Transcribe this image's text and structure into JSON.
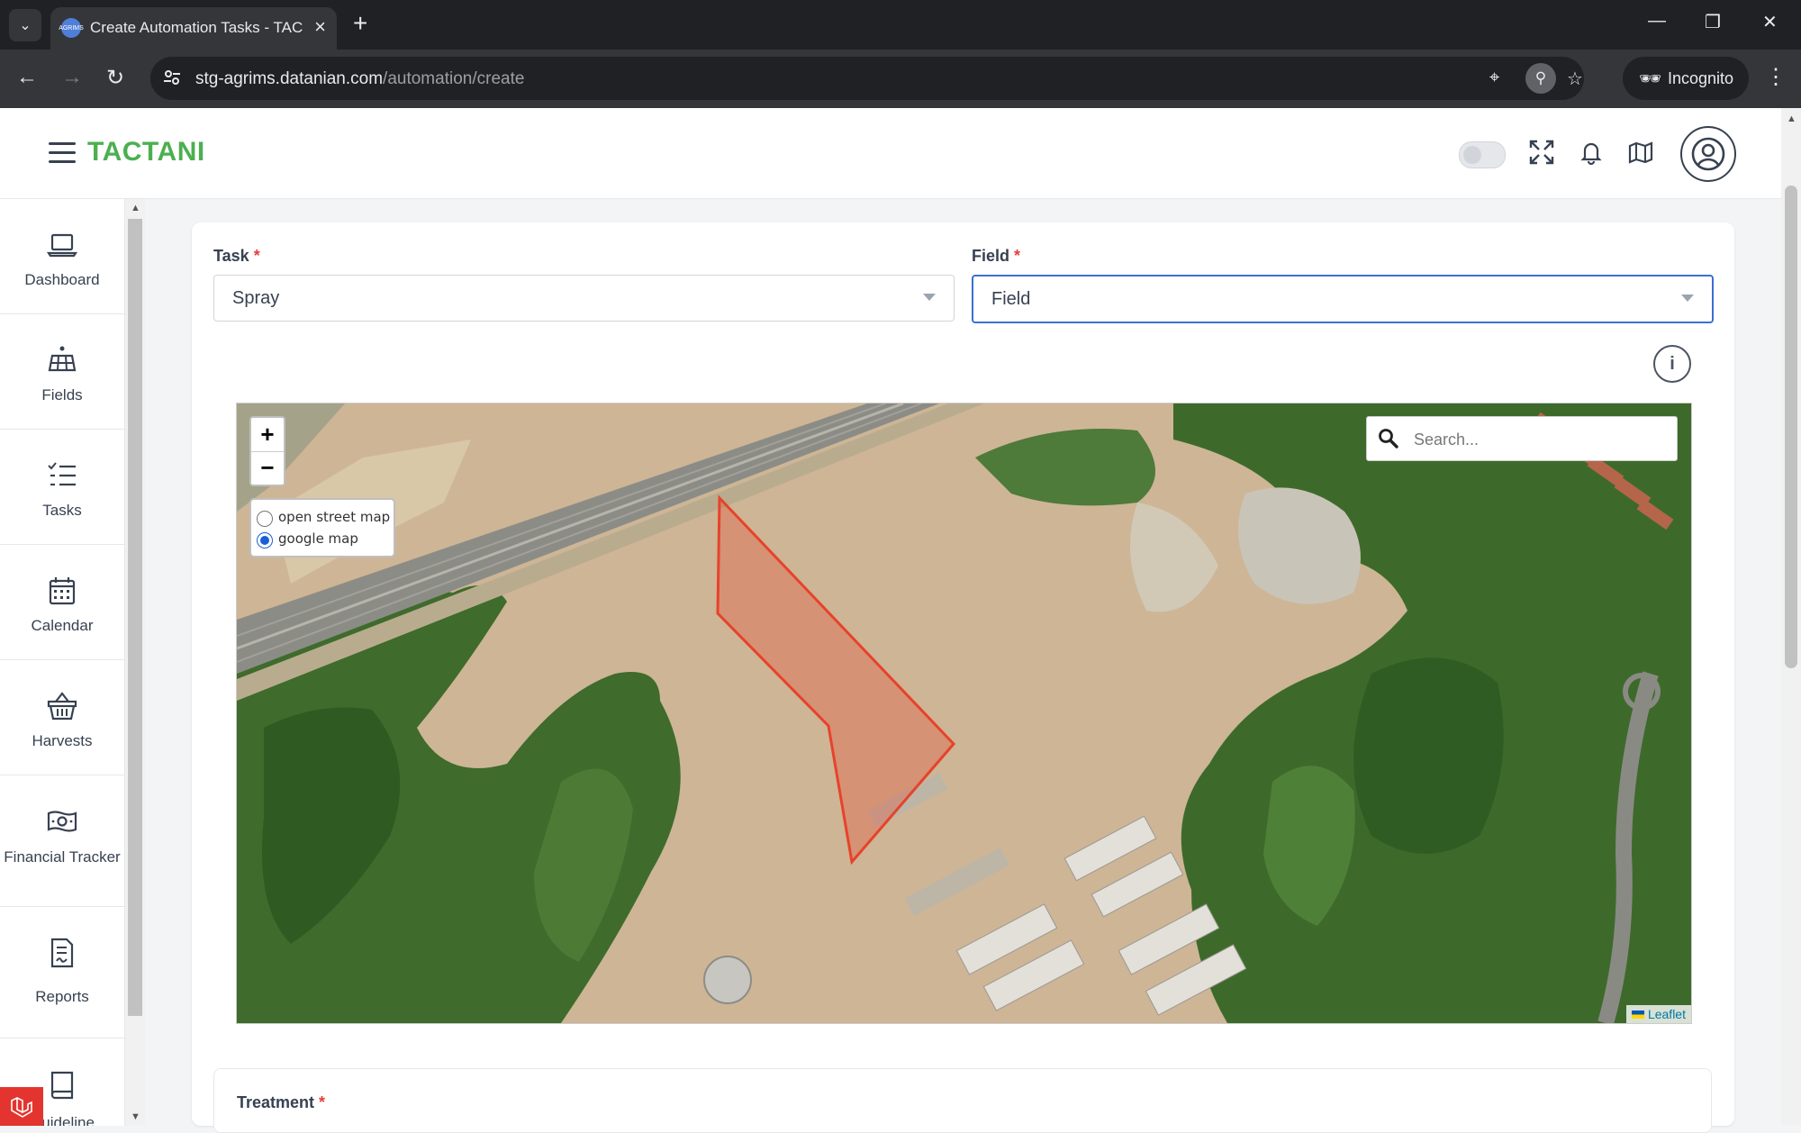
{
  "browser": {
    "tab_title": "Create Automation Tasks - TACTANI",
    "favicon_text": "AGRIMS",
    "url_host": "stg-agrims.datanian.com",
    "url_path": "/automation/create",
    "incognito_label": "Incognito"
  },
  "header": {
    "brand": "TACTANI"
  },
  "sidebar": {
    "items": [
      {
        "label": "Dashboard",
        "icon": "laptop-icon"
      },
      {
        "label": "Fields",
        "icon": "solar-panel-icon"
      },
      {
        "label": "Tasks",
        "icon": "checklist-icon"
      },
      {
        "label": "Calendar",
        "icon": "calendar-icon"
      },
      {
        "label": "Harvests",
        "icon": "basket-icon"
      },
      {
        "label": "Financial Tracker",
        "icon": "money-icon"
      },
      {
        "label": "Reports",
        "icon": "report-icon"
      },
      {
        "label": "Guideline",
        "icon": "book-icon"
      }
    ]
  },
  "form": {
    "task_label": "Task",
    "task_value": "Spray",
    "field_label": "Field",
    "field_value": "Field",
    "required_mark": "*",
    "treatment_label": "Treatment"
  },
  "map": {
    "zoom_in": "+",
    "zoom_out": "−",
    "layers": [
      {
        "label": "open street map",
        "selected": false
      },
      {
        "label": "google map",
        "selected": true
      }
    ],
    "search_placeholder": "Search...",
    "attribution": "Leaflet",
    "polygon_color": "#e8422a"
  },
  "colors": {
    "brand": "#4caf50",
    "focus": "#3b6fd4",
    "required": "#e53e3e"
  }
}
